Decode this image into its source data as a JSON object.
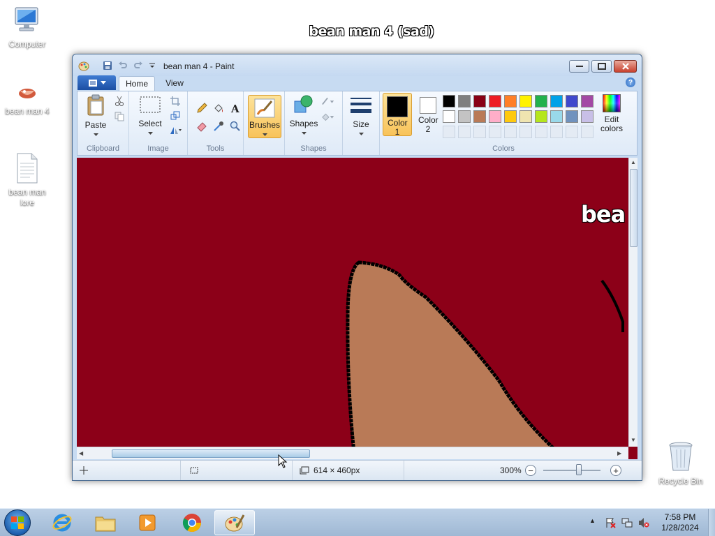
{
  "desktop": {
    "background_color": "#8c0018",
    "wallpaper_title": "bean man 4 (sad)",
    "icons": [
      {
        "label": "Computer"
      },
      {
        "label": "bean man 4"
      },
      {
        "label": "bean man lore"
      },
      {
        "label": "Recycle Bin"
      }
    ]
  },
  "window": {
    "title": "bean man 4 - Paint",
    "tabs": [
      "Home",
      "View"
    ],
    "ribbon": {
      "clipboard": {
        "paste_label": "Paste",
        "group_label": "Clipboard"
      },
      "image": {
        "select_label": "Select",
        "group_label": "Image"
      },
      "tools": {
        "group_label": "Tools"
      },
      "brushes_label": "Brushes",
      "shapes": {
        "shapes_label": "Shapes",
        "group_label": "Shapes"
      },
      "size_label": "Size",
      "color1_label": "Color 1",
      "color2_label": "Color 2",
      "colors": {
        "group_label": "Colors",
        "edit_label": "Edit colors"
      },
      "palette_row1": [
        "#000000",
        "#7f7f7f",
        "#880015",
        "#ed1c24",
        "#ff7f27",
        "#fff200",
        "#22b14c",
        "#00a2e8",
        "#3f48cc",
        "#a349a4"
      ],
      "palette_row2": [
        "#ffffff",
        "#c3c3c3",
        "#b97a57",
        "#ffaec9",
        "#ffc90e",
        "#efe4b0",
        "#b5e61d",
        "#99d9ea",
        "#7092be",
        "#c8bfe7"
      ]
    },
    "canvas": {
      "fill_color": "#8c0018",
      "bean_color": "#b97a57",
      "partial_text": "bea"
    },
    "statusbar": {
      "image_size": "614 × 460px",
      "zoom": "300%"
    }
  },
  "taskbar": {
    "time": "7:58 PM",
    "date": "1/28/2024"
  }
}
